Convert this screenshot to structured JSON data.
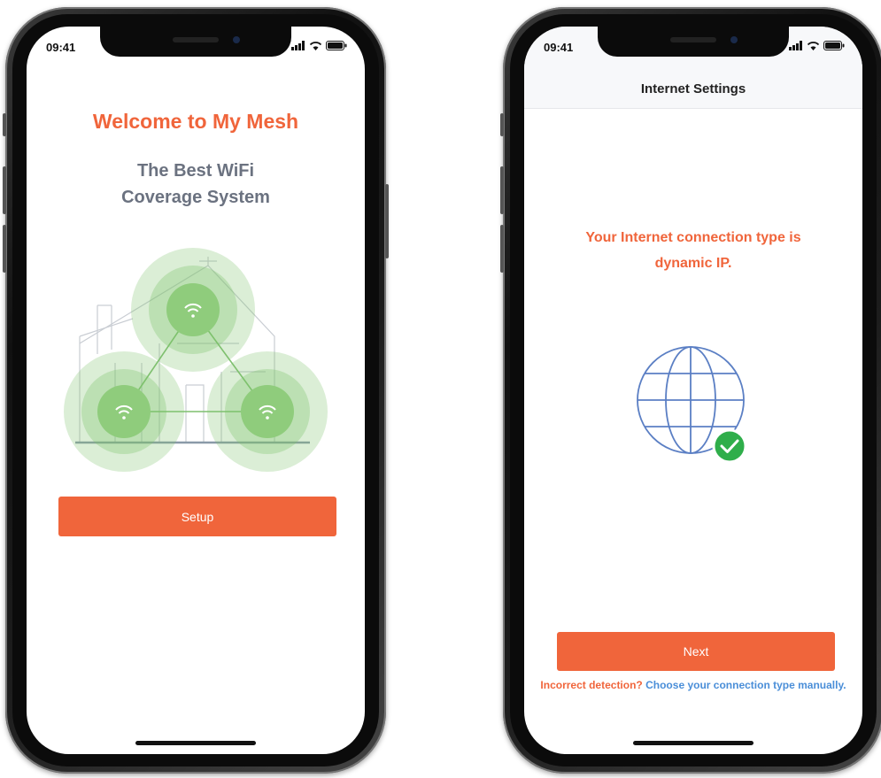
{
  "left_phone": {
    "status_time": "09:41",
    "title": "Welcome to My Mesh",
    "subtitle_line1": "The Best WiFi",
    "subtitle_line2": "Coverage System",
    "setup_label": "Setup"
  },
  "right_phone": {
    "status_time": "09:41",
    "nav_title": "Internet Settings",
    "connection_line1": "Your Internet connection type is",
    "connection_line2": "dynamic IP.",
    "next_label": "Next",
    "incorrect_text": "Incorrect detection?",
    "manual_link": "Choose your connection type manually."
  },
  "colors": {
    "accent_orange": "#f0653b",
    "link_blue": "#4a8ed8",
    "mesh_green": "#7cc36b",
    "success_green": "#2fae4a",
    "globe_blue": "#5b7fc4"
  }
}
